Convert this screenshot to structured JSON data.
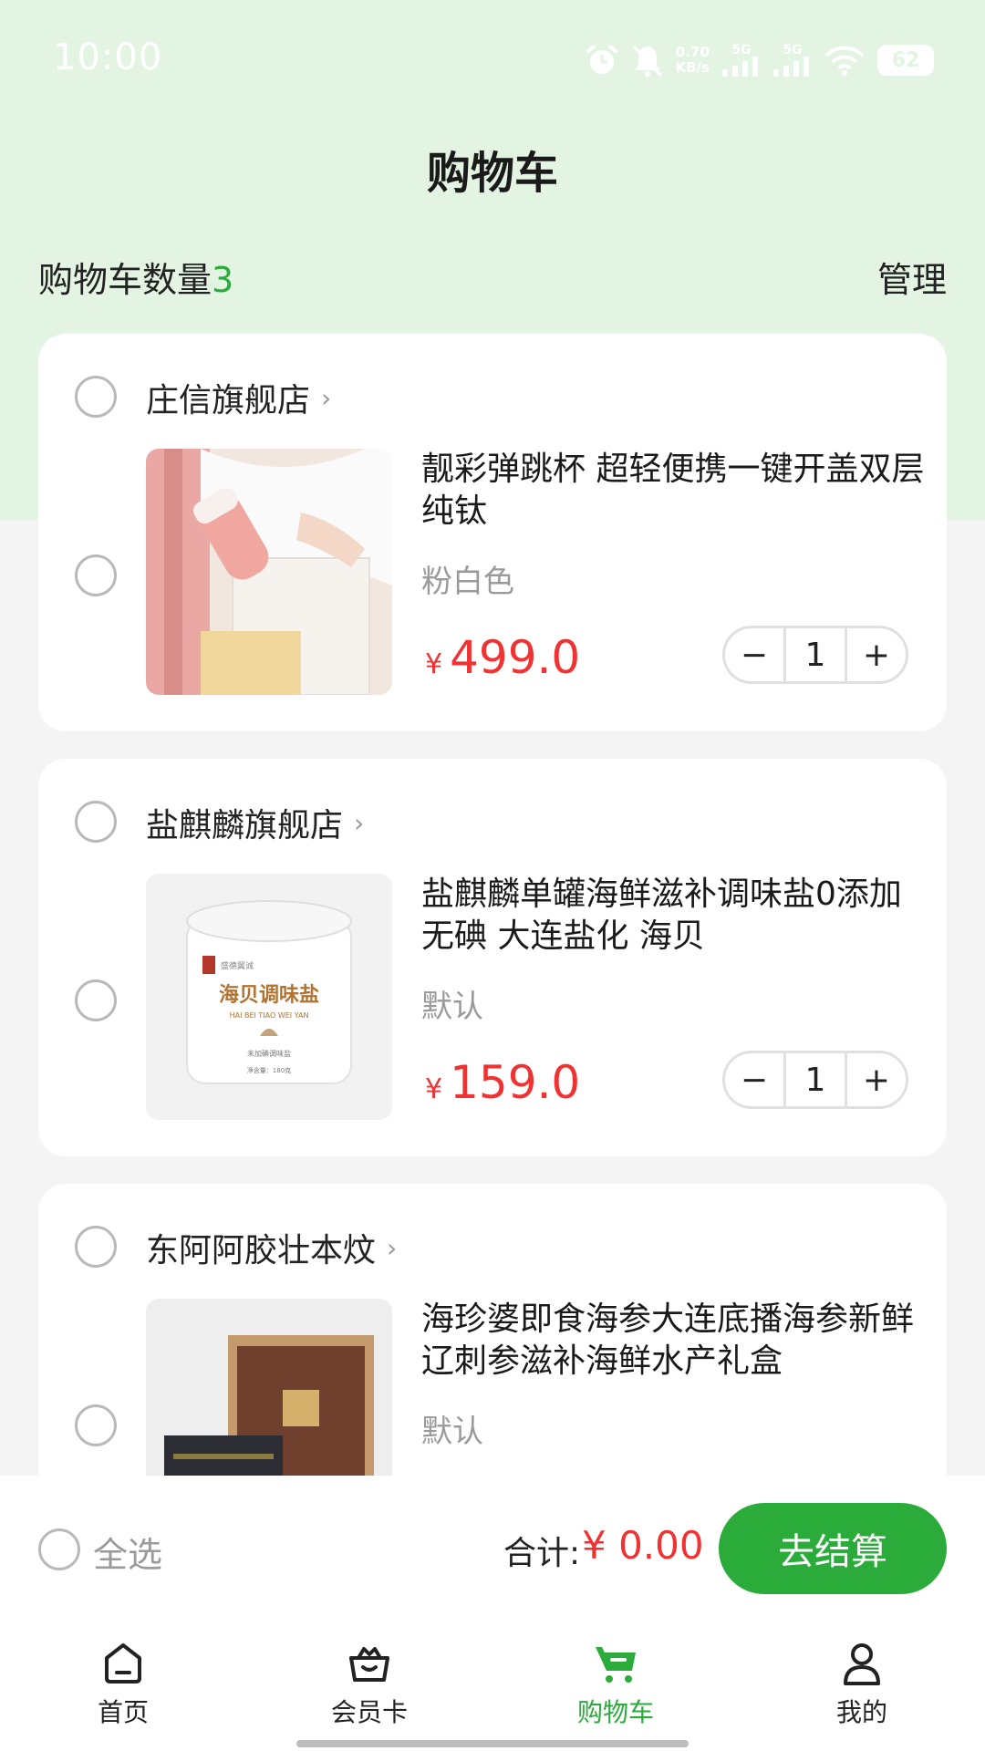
{
  "status_bar": {
    "time": "10:00",
    "net_speed_value": "0.70",
    "net_speed_unit": "KB/s",
    "signal1": "5G",
    "signal2": "5G",
    "battery": "62"
  },
  "header": {
    "title": "购物车",
    "count_label": "购物车数量",
    "count_value": "3",
    "manage_label": "管理"
  },
  "stores": [
    {
      "name": "庄信旗舰店",
      "product": {
        "title": "靓彩弹跳杯 超轻便携一键开盖双层纯钛",
        "spec": "粉白色",
        "currency": "¥",
        "price": "499.0",
        "quantity": "1"
      }
    },
    {
      "name": "盐麒麟旗舰店",
      "product": {
        "title": "盐麒麟单罐海鲜滋补调味盐0添加无碘 大连盐化 海贝",
        "spec": "默认",
        "currency": "¥",
        "price": "159.0",
        "quantity": "1",
        "image_text": {
          "brand": "盛德翼诚",
          "name_cn": "海贝调味盐",
          "name_py": "HAI BEI TIAO WEI YAN",
          "sub": "未加碘调味盐",
          "net": "净含量：180克"
        }
      }
    },
    {
      "name": "东阿阿胶壮本炆",
      "product": {
        "title": "海珍婆即食海参大连底播海参新鲜辽刺参滋补海鲜水产礼盒",
        "spec": "默认"
      }
    }
  ],
  "checkout": {
    "select_all_label": "全选",
    "total_label": "合计:",
    "total_amount": "¥ 0.00",
    "checkout_label": "去结算"
  },
  "tabs": [
    {
      "label": "首页",
      "icon": "home-icon"
    },
    {
      "label": "会员卡",
      "icon": "crown-basket-icon"
    },
    {
      "label": "购物车",
      "icon": "cart-icon",
      "active": true
    },
    {
      "label": "我的",
      "icon": "person-icon"
    }
  ],
  "colors": {
    "accent": "#2aab3a",
    "price": "#f03232",
    "header_bg": "#e3f4e3"
  }
}
